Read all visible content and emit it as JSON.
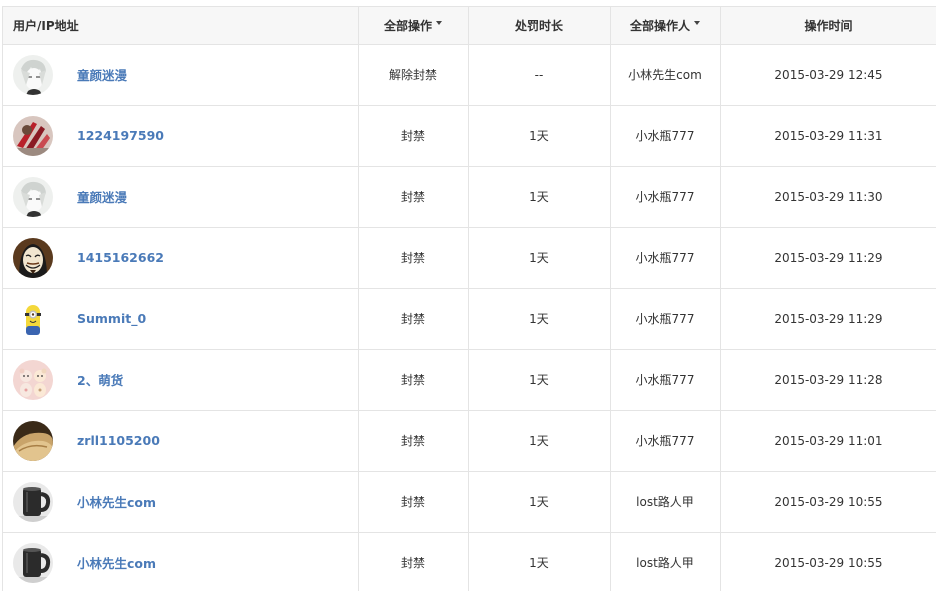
{
  "columns": {
    "user": "用户/IP地址",
    "action": "全部操作",
    "duration": "处罚时长",
    "operator": "全部操作人",
    "time": "操作时间"
  },
  "icons": {
    "action_filter": "caret-down-icon",
    "operator_filter": "caret-down-icon"
  },
  "rows": [
    {
      "user": "童颜迷漫",
      "action": "解除封禁",
      "duration": "--",
      "operator": "小林先生com",
      "time": "2015-03-29 12:45",
      "avatar": "avatar-anime-white"
    },
    {
      "user": "1224197590",
      "action": "封禁",
      "duration": "1天",
      "operator": "小水瓶777",
      "time": "2015-03-29 11:31",
      "avatar": "avatar-red-fan"
    },
    {
      "user": "童颜迷漫",
      "action": "封禁",
      "duration": "1天",
      "operator": "小水瓶777",
      "time": "2015-03-29 11:30",
      "avatar": "avatar-anime-white"
    },
    {
      "user": "1415162662",
      "action": "封禁",
      "duration": "1天",
      "operator": "小水瓶777",
      "time": "2015-03-29 11:29",
      "avatar": "avatar-mask"
    },
    {
      "user": "Summit_0",
      "action": "封禁",
      "duration": "1天",
      "operator": "小水瓶777",
      "time": "2015-03-29 11:29",
      "avatar": "avatar-minion"
    },
    {
      "user": "2、萌货",
      "action": "封禁",
      "duration": "1天",
      "operator": "小水瓶777",
      "time": "2015-03-29 11:28",
      "avatar": "avatar-pink-bears"
    },
    {
      "user": "zrll1105200",
      "action": "封禁",
      "duration": "1天",
      "operator": "小水瓶777",
      "time": "2015-03-29 11:01",
      "avatar": "avatar-bread"
    },
    {
      "user": "小林先生com",
      "action": "封禁",
      "duration": "1天",
      "operator": "lost路人甲",
      "time": "2015-03-29 10:55",
      "avatar": "avatar-black-cup"
    },
    {
      "user": "小林先生com",
      "action": "封禁",
      "duration": "1天",
      "operator": "lost路人甲",
      "time": "2015-03-29 10:55",
      "avatar": "avatar-black-cup"
    }
  ],
  "colors": {
    "link": "#4a7ab8",
    "header_bg": "#f7f7f7",
    "border": "#e4e4e4"
  }
}
